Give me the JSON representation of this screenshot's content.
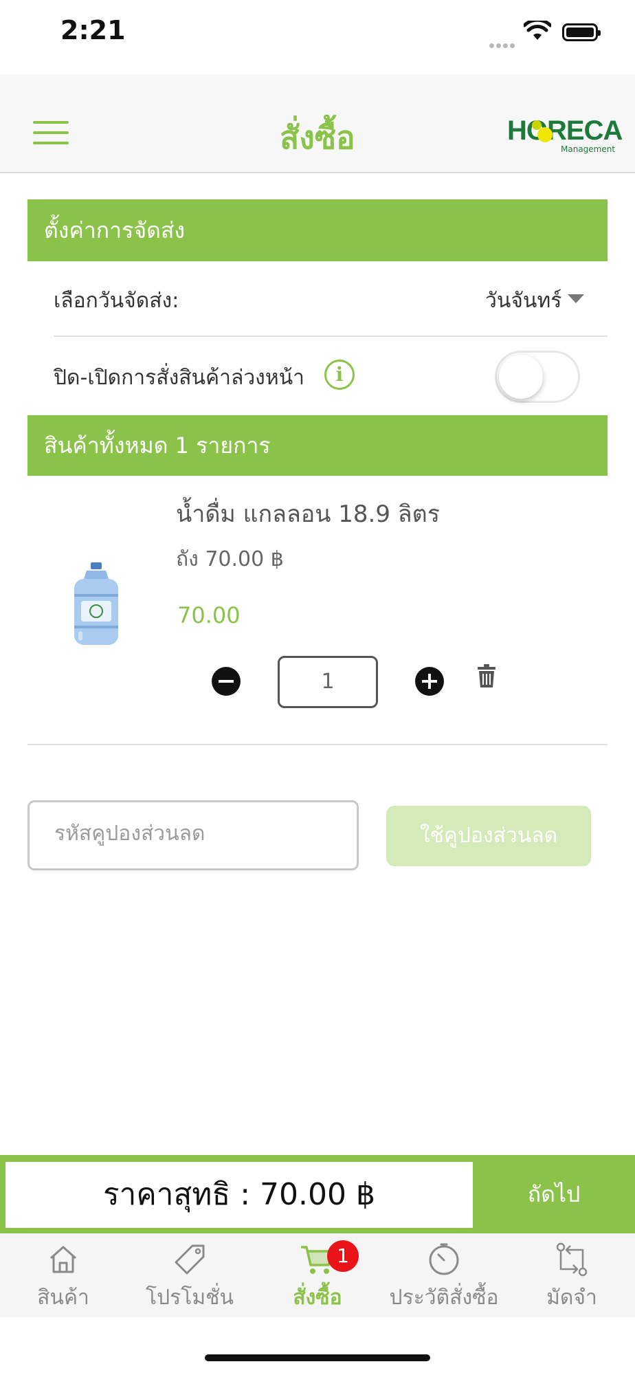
{
  "status_bar": {
    "time": "2:21"
  },
  "header": {
    "title": "สั่งซื้อ",
    "logo_text": "HORECA",
    "logo_subtext": "Management"
  },
  "delivery": {
    "section_title": "ตั้งค่าการจัดส่ง",
    "day_label": "เลือกวันจัดส่ง:",
    "day_value": "วันจันทร์",
    "preorder_label": "ปิด-เปิดการสั่งสินค้าล่วงหน้า",
    "preorder_enabled": false
  },
  "items": {
    "section_title": "สินค้าทั้งหมด 1 รายการ",
    "list": [
      {
        "name": "น้ำดื่ม แกลลอน 18.9 ลิตร",
        "unit_price": "ถัง 70.00 ฿",
        "total": "70.00",
        "quantity": "1"
      }
    ]
  },
  "coupon": {
    "placeholder": "รหัสคูปองส่วนลด",
    "apply_label": "ใช้คูปองส่วนลด"
  },
  "summary": {
    "total_text": "ราคาสุทธิ : 70.00 ฿",
    "next_label": "ถัดไป"
  },
  "tabs": [
    {
      "label": "สินค้า",
      "icon": "home-icon"
    },
    {
      "label": "โปรโมชั่น",
      "icon": "tag-icon"
    },
    {
      "label": "สั่งซื้อ",
      "icon": "cart-icon",
      "badge": "1",
      "active": true
    },
    {
      "label": "ประวัติสั่งซื้อ",
      "icon": "clock-icon"
    },
    {
      "label": "มัดจำ",
      "icon": "exchange-icon"
    }
  ],
  "colors": {
    "accent": "#8bc34a",
    "accent_light": "#d4eab8",
    "badge": "#e8141a"
  }
}
